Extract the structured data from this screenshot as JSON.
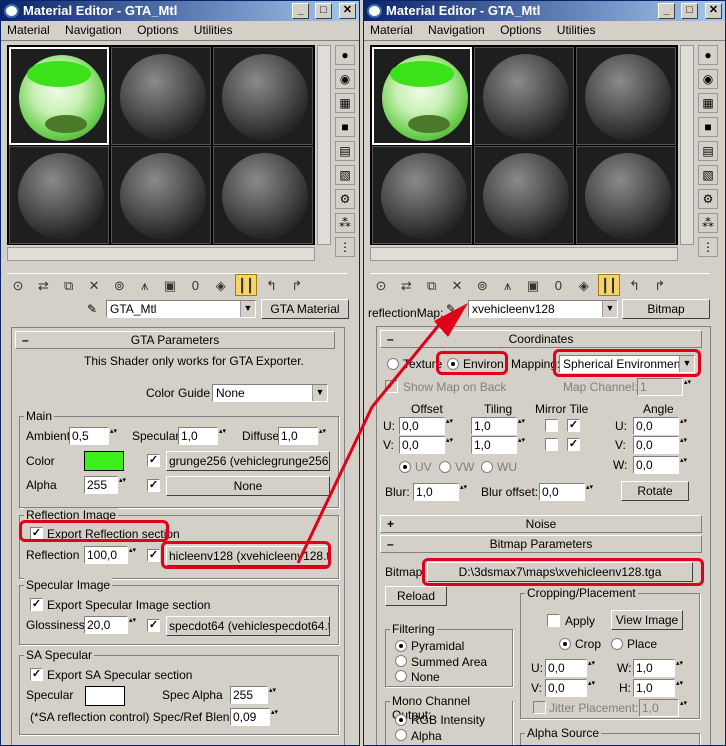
{
  "left": {
    "title": "Material Editor - GTA_Mtl",
    "menu": [
      "Material",
      "Navigation",
      "Options",
      "Utilities"
    ],
    "material_name": "GTA_Mtl",
    "material_type": "GTA Material",
    "gta_header": "GTA Parameters",
    "shader_note": "This Shader only works for GTA Exporter.",
    "color_guide_label": "Color Guide",
    "color_guide_value": "None",
    "main_label": "Main",
    "ambient_label": "Ambient",
    "ambient_value": "0,5",
    "specular_label": "Specular",
    "specular_value": "1,0",
    "diffuse_label": "Diffuse",
    "diffuse_value": "1,0",
    "color_label": "Color",
    "color_swatch": "#3cf01c",
    "diffuse_map": "grunge256 (vehiclegrunge256.tga)",
    "alpha_label": "Alpha",
    "alpha_value": "255",
    "alpha_map": "None",
    "refl_group": "Reflection Image",
    "export_refl": "Export Reflection section",
    "reflection_label": "Reflection",
    "reflection_value": "100,0",
    "reflection_map": "hicleenv128 (xvehicleenv128.tga)",
    "spec_group": "Specular Image",
    "export_spec": "Export Specular Image section",
    "gloss_label": "Glossiness",
    "gloss_value": "20,0",
    "spec_map": "specdot64 (vehiclespecdot64.tga)",
    "sa_group": "SA Specular",
    "export_sa": "Export SA Specular section",
    "sa_specular_label": "Specular",
    "spec_alpha_label": "Spec Alpha",
    "spec_alpha_value": "255",
    "sa_note": "(*SA reflection control) Spec/Ref Blend",
    "blend_value": "0,09"
  },
  "right": {
    "title": "Material Editor - GTA_Mtl",
    "menu": [
      "Material",
      "Navigation",
      "Options",
      "Utilities"
    ],
    "slot_label": "reflectionMap:",
    "map_name": "xvehicleenv128",
    "map_type": "Bitmap",
    "coord_header": "Coordinates",
    "texture_label": "Texture",
    "environ_label": "Environ",
    "mapping_label": "Mapping:",
    "mapping_value": "Spherical Environment",
    "show_map_label": "Show Map on Back",
    "map_channel_label": "Map Channel:",
    "map_channel_value": "1",
    "offset_label": "Offset",
    "tiling_label": "Tiling",
    "mirror_tile_label": "Mirror Tile",
    "angle_label": "Angle",
    "u_label": "U:",
    "v_label": "V:",
    "w_label": "W:",
    "offset_u": "0,0",
    "offset_v": "0,0",
    "tiling_u": "1,0",
    "tiling_v": "1,0",
    "angle_u": "0,0",
    "angle_v": "0,0",
    "angle_w": "0,0",
    "uv_label": "UV",
    "vw_label": "VW",
    "wu_label": "WU",
    "blur_label": "Blur:",
    "blur_value": "1,0",
    "blur_offset_label": "Blur offset:",
    "blur_offset_value": "0,0",
    "rotate_label": "Rotate",
    "noise_header": "Noise",
    "bitmap_header": "Bitmap Parameters",
    "bitmap_label": "Bitmap:",
    "bitmap_path": "D:\\3dsmax7\\maps\\xvehicleenv128.tga",
    "reload_label": "Reload",
    "crop_group": "Cropping/Placement",
    "apply_label": "Apply",
    "view_image_label": "View Image",
    "crop_label": "Crop",
    "place_label": "Place",
    "u_crop": "0,0",
    "v_crop": "0,0",
    "w_crop": "1,0",
    "h_label": "H:",
    "h_crop": "1,0",
    "jitter_label": "Jitter Placement:",
    "jitter_value": "1,0",
    "filtering_group": "Filtering",
    "pyramidal_label": "Pyramidal",
    "summed_label": "Summed Area",
    "none_label": "None",
    "mono_group": "Mono Channel Output:",
    "rgb_label": "RGB Intensity",
    "alpha_label": "Alpha",
    "alpha_source_group": "Alpha Source"
  },
  "colors": {
    "highlight": "#e0001a",
    "title_bar": "#0a246a"
  }
}
